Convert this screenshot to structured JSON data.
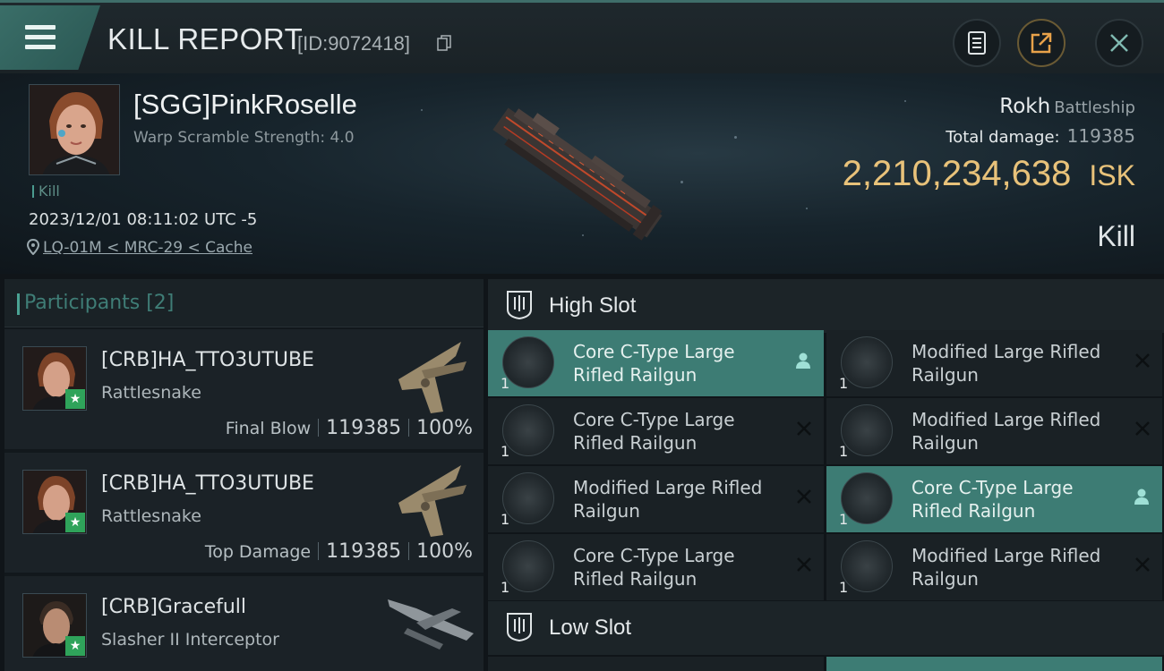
{
  "header": {
    "title": "KILL REPORT",
    "kill_id": "[ID:9072418]"
  },
  "victim": {
    "name": "[SGG]PinkRoselle",
    "stat": "Warp Scramble Strength: 4.0",
    "tag": "Kill",
    "timestamp": "2023/12/01 08:11:02 UTC -5",
    "location": "LQ-01M < MRC-29 < Cache",
    "ship": "Rokh",
    "ship_class": "Battleship",
    "total_damage_label": "Total damage:",
    "total_damage": "119385",
    "isk_value": "2,210,234,638",
    "isk_unit": "ISK",
    "result": "Kill"
  },
  "participants": {
    "title": "Participants [2]",
    "rows": [
      {
        "name": "[CRB]HA_TTO3UTUBE",
        "ship": "Rattlesnake",
        "role": "Final Blow",
        "damage": "119385",
        "percent": "100%"
      },
      {
        "name": "[CRB]HA_TTO3UTUBE",
        "ship": "Rattlesnake",
        "role": "Top Damage",
        "damage": "119385",
        "percent": "100%"
      },
      {
        "name": "[CRB]Gracefull",
        "ship": "Slasher II Interceptor",
        "role": "",
        "damage": "",
        "percent": ""
      }
    ]
  },
  "high_slot": {
    "label": "High Slot",
    "modules": [
      {
        "name": "Core C-Type Large Rifled Railgun",
        "qty": "1",
        "state": "fitted"
      },
      {
        "name": "Modified Large Rifled Railgun",
        "qty": "1",
        "state": "destroyed"
      },
      {
        "name": "Core C-Type Large Rifled Railgun",
        "qty": "1",
        "state": "destroyed"
      },
      {
        "name": "Modified Large Rifled Railgun",
        "qty": "1",
        "state": "destroyed"
      },
      {
        "name": "Modified Large Rifled Railgun",
        "qty": "1",
        "state": "destroyed"
      },
      {
        "name": "Core C-Type Large Rifled Railgun",
        "qty": "1",
        "state": "fitted"
      },
      {
        "name": "Core C-Type Large Rifled Railgun",
        "qty": "1",
        "state": "destroyed"
      },
      {
        "name": "Modified Large Rifled Railgun",
        "qty": "1",
        "state": "destroyed"
      }
    ]
  },
  "low_slot": {
    "label": "Low Slot"
  }
}
